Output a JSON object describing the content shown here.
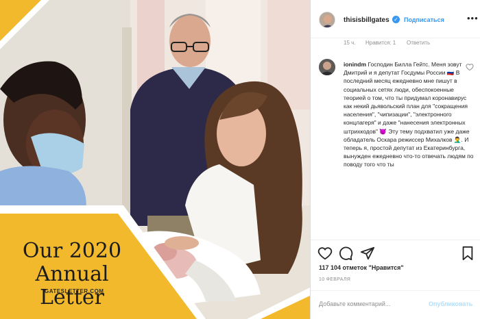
{
  "post": {
    "letter_title_line1": "Our 2020",
    "letter_title_line2": "Annual Letter",
    "site": "GATESLETTER.COM"
  },
  "header": {
    "username": "thisisbillgates",
    "verified_mark": "✓",
    "follow_label": "Подписаться",
    "more_label": "•••"
  },
  "meta": {
    "time": "15 ч.",
    "likes": "Нравится: 1",
    "reply": "Ответить"
  },
  "comment": {
    "user": "ionindm",
    "text": "Господин Билла Гейтс. Меня зовут Дмитрий и я депутат Госдумы России 🇷🇺 В последний месяц ежедневно мне пишут в социальных сетях люди, обеспокоенные теорией о том, что ты придумал коронавирус как некий дьявольский план для \"сокращения населения\", \"чипизации\", \"электронного концлагеря\" и даже \"нанесения электронных штрихкодов\" 😈 Эту тему подхватил уже даже обладатель Оскара режиссер Михалков 🤦‍♂️. И теперь я, простой депутат из Екатеринбурга, вынужден ежедневно что-то отвечать людям по поводу того что ты"
  },
  "footer": {
    "likes_count": "117 104 отметок \"Нравится\"",
    "date": "10 ФЕВРАЛЯ",
    "add_comment_placeholder": "Добавьте комментарий...",
    "publish_label": "Опубликовать"
  },
  "colors": {
    "accent": "#3897f0",
    "yellow": "#f2b92d",
    "text": "#262626",
    "muted": "#8e8e8e"
  }
}
